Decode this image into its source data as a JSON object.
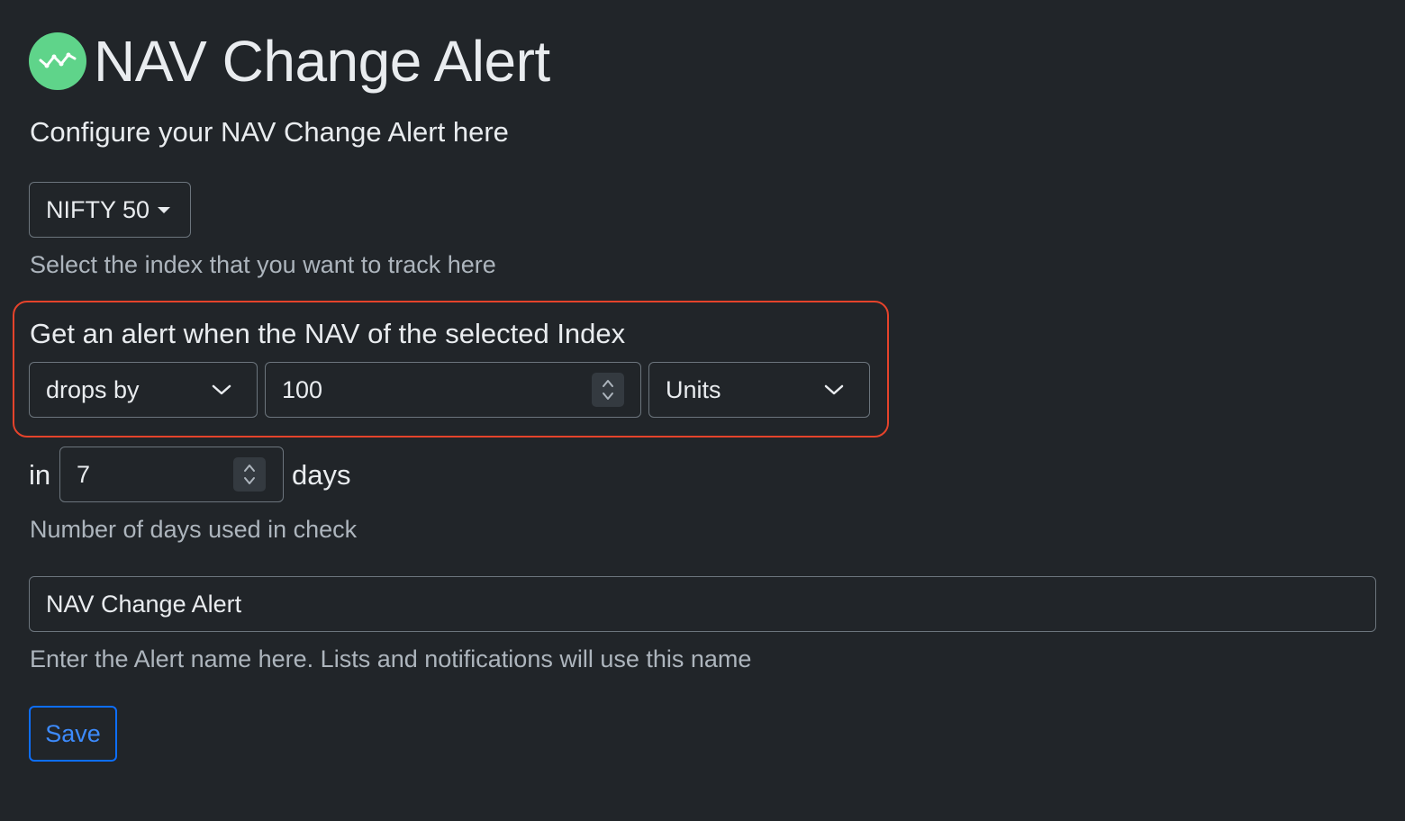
{
  "header": {
    "title": "NAV Change Alert",
    "subtitle": "Configure your NAV Change Alert here",
    "logo_icon": "line-chart-icon",
    "logo_color": "#5fd48a"
  },
  "index_select": {
    "selected": "NIFTY 50",
    "help": "Select the index that you want to track here"
  },
  "condition": {
    "label": "Get an alert when the NAV of the selected Index",
    "direction": "drops by",
    "amount": "100",
    "unit": "Units",
    "highlight_color": "#e5432b"
  },
  "period": {
    "prefix": "in",
    "days": "7",
    "suffix": "days",
    "help": "Number of days used in check"
  },
  "alert_name": {
    "value": "NAV Change Alert",
    "help": "Enter the Alert name here. Lists and notifications will use this name"
  },
  "actions": {
    "save_label": "Save",
    "accent": "#0d6efd"
  }
}
